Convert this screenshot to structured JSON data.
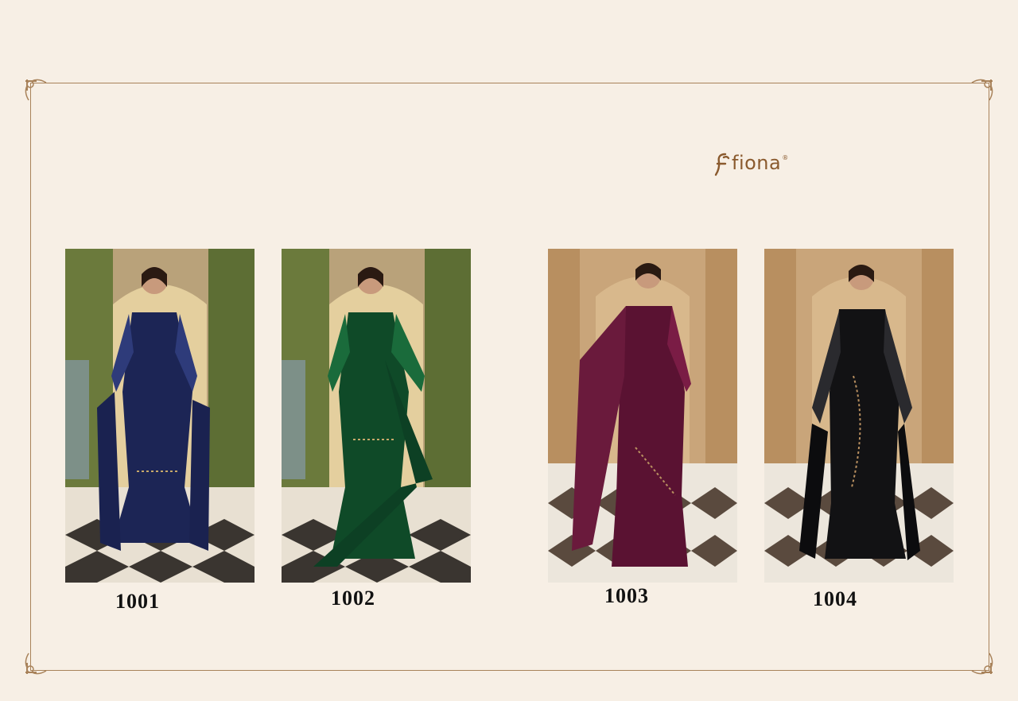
{
  "brand": {
    "name": "fiona",
    "mark": "®"
  },
  "products": [
    {
      "code": "1001",
      "color": "#1c2555",
      "accent": "#2e3b7a",
      "bg": "arch-garden"
    },
    {
      "code": "1002",
      "color": "#0f4a28",
      "accent": "#1a6b3b",
      "bg": "arch-garden"
    },
    {
      "code": "1003",
      "color": "#5a1232",
      "accent": "#7a1c45",
      "bg": "hall-columns"
    },
    {
      "code": "1004",
      "color": "#121214",
      "accent": "#2a2a2e",
      "bg": "hall-columns"
    }
  ],
  "colors": {
    "frame": "#a8825a",
    "page": "#f7efe5",
    "brand": "#8a5a2e"
  }
}
